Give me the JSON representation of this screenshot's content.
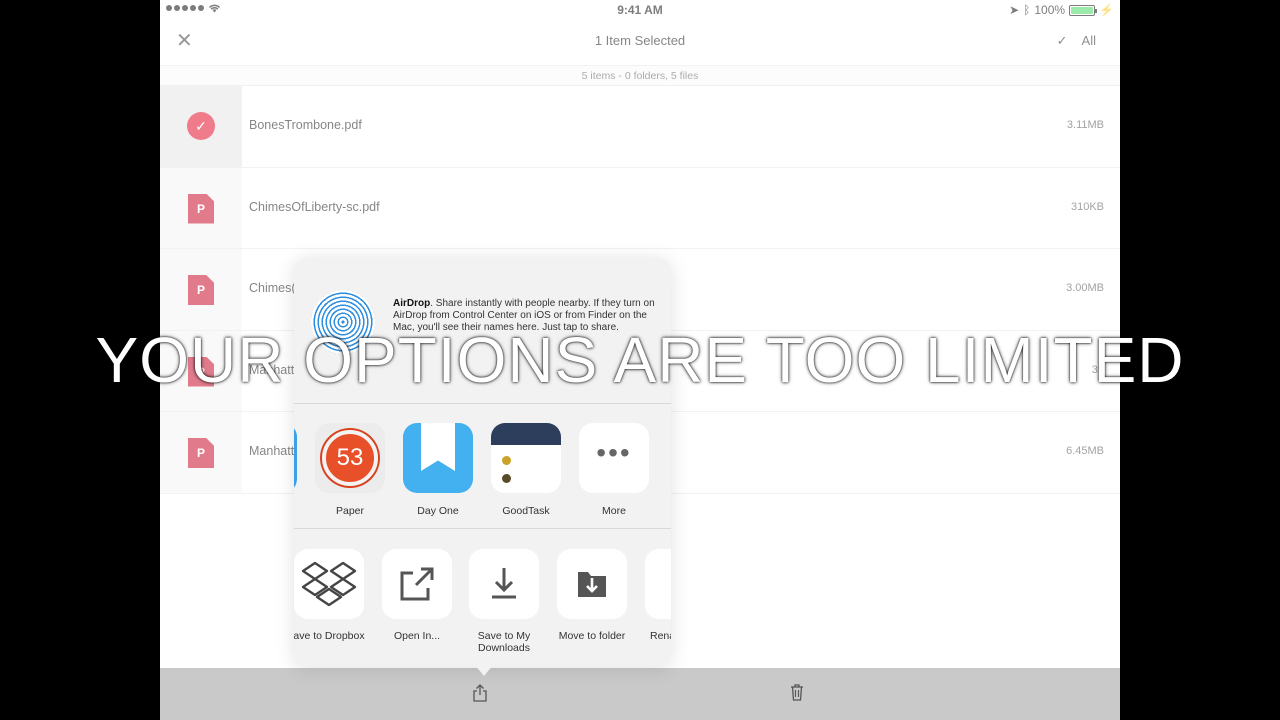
{
  "status_bar": {
    "time": "9:41 AM",
    "battery": "100%"
  },
  "nav": {
    "title": "1 Item Selected",
    "all_label": "All"
  },
  "summary": "5 items - 0 folders, 5 files",
  "files": [
    {
      "name": "BonesTrombone.pdf",
      "size": "3.11MB",
      "selected": true
    },
    {
      "name": "ChimesOfLiberty-sc.pdf",
      "size": "310KB",
      "selected": false
    },
    {
      "name": "Chimes(",
      "size": "3.00MB",
      "selected": false
    },
    {
      "name": "Manhatt",
      "size": "39",
      "selected": false
    },
    {
      "name": "Manhatt",
      "size": "6.45MB",
      "selected": false
    }
  ],
  "pdf_icon_letter": "P",
  "share_sheet": {
    "airdrop_title": "AirDrop",
    "airdrop_text": ". Share instantly with people nearby. If they turn on AirDrop from Control Center on iOS or from Finder on the Mac, you'll see their names here. Just tap to share.",
    "apps": [
      {
        "label": "Paper",
        "badge": "53"
      },
      {
        "label": "Day One"
      },
      {
        "label": "GoodTask"
      },
      {
        "label": "More",
        "glyph": "•••"
      }
    ],
    "actions": [
      {
        "label": "ave to Dropbox",
        "icon": "dropbox-icon"
      },
      {
        "label": "Open In...",
        "icon": "open-in-icon"
      },
      {
        "label": "Save to My Downloads",
        "icon": "download-icon"
      },
      {
        "label": "Move to folder",
        "icon": "move-folder-icon"
      },
      {
        "label": "Rena",
        "icon": "rename-icon"
      }
    ]
  },
  "caption": "YOUR OPTIONS ARE TOO LIMITED"
}
